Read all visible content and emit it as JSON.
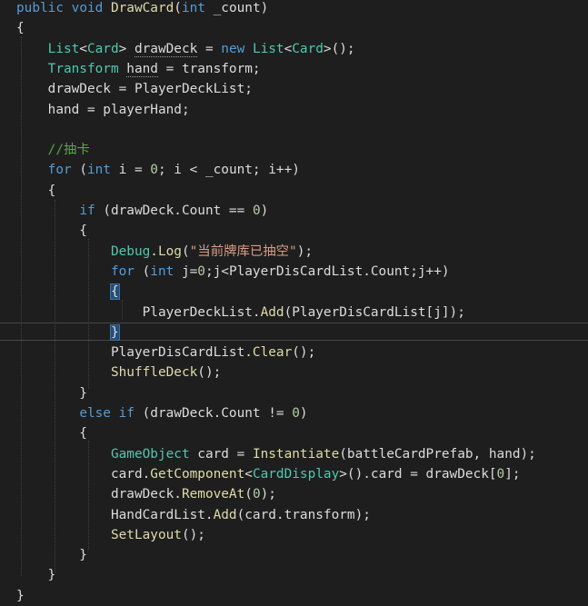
{
  "editor": {
    "lines": [
      [
        {
          "t": "public ",
          "c": "kw"
        },
        {
          "t": "void ",
          "c": "kw"
        },
        {
          "t": "DrawCard",
          "c": "method"
        },
        {
          "t": "(",
          "c": "p"
        },
        {
          "t": "int ",
          "c": "kw"
        },
        {
          "t": "_count)",
          "c": "p"
        }
      ],
      [
        {
          "t": "{",
          "c": "p"
        }
      ],
      [
        {
          "t": "    ",
          "c": "p"
        },
        {
          "t": "List",
          "c": "type"
        },
        {
          "t": "<",
          "c": "p"
        },
        {
          "t": "Card",
          "c": "type"
        },
        {
          "t": "> ",
          "c": "p"
        },
        {
          "t": "drawDeck",
          "c": "ul"
        },
        {
          "t": " = ",
          "c": "p"
        },
        {
          "t": "new ",
          "c": "kw"
        },
        {
          "t": "List",
          "c": "type"
        },
        {
          "t": "<",
          "c": "p"
        },
        {
          "t": "Card",
          "c": "type"
        },
        {
          "t": ">();",
          "c": "p"
        }
      ],
      [
        {
          "t": "    ",
          "c": "p"
        },
        {
          "t": "Transform ",
          "c": "type"
        },
        {
          "t": "hand",
          "c": "ul"
        },
        {
          "t": " = transform;",
          "c": "p"
        }
      ],
      [
        {
          "t": "    drawDeck = PlayerDeckList;",
          "c": "p"
        }
      ],
      [
        {
          "t": "    hand = playerHand;",
          "c": "p"
        }
      ],
      [
        {
          "t": "",
          "c": "p"
        }
      ],
      [
        {
          "t": "    ",
          "c": "p"
        },
        {
          "t": "//抽卡",
          "c": "cmt"
        }
      ],
      [
        {
          "t": "    ",
          "c": "p"
        },
        {
          "t": "for ",
          "c": "kw"
        },
        {
          "t": "(",
          "c": "p"
        },
        {
          "t": "int ",
          "c": "kw"
        },
        {
          "t": "i = ",
          "c": "p"
        },
        {
          "t": "0",
          "c": "num"
        },
        {
          "t": "; i < _count; i++)",
          "c": "p"
        }
      ],
      [
        {
          "t": "    {",
          "c": "p"
        }
      ],
      [
        {
          "t": "        ",
          "c": "p"
        },
        {
          "t": "if ",
          "c": "kw"
        },
        {
          "t": "(drawDeck.Count == ",
          "c": "p"
        },
        {
          "t": "0",
          "c": "num"
        },
        {
          "t": ")",
          "c": "p"
        }
      ],
      [
        {
          "t": "        {",
          "c": "p"
        }
      ],
      [
        {
          "t": "            ",
          "c": "p"
        },
        {
          "t": "Debug",
          "c": "type"
        },
        {
          "t": ".",
          "c": "p"
        },
        {
          "t": "Log",
          "c": "method"
        },
        {
          "t": "(",
          "c": "p"
        },
        {
          "t": "\"当前牌库已抽空\"",
          "c": "str"
        },
        {
          "t": ");",
          "c": "p"
        }
      ],
      [
        {
          "t": "            ",
          "c": "p"
        },
        {
          "t": "for ",
          "c": "kw"
        },
        {
          "t": "(",
          "c": "p"
        },
        {
          "t": "int ",
          "c": "kw"
        },
        {
          "t": "j=",
          "c": "p"
        },
        {
          "t": "0",
          "c": "num"
        },
        {
          "t": ";j<PlayerDisCardList.Count;j++)",
          "c": "p"
        }
      ],
      [
        {
          "t": "            ",
          "c": "p"
        },
        {
          "t": "{",
          "c": "brace-hl"
        }
      ],
      [
        {
          "t": "                PlayerDeckList.",
          "c": "p"
        },
        {
          "t": "Add",
          "c": "method"
        },
        {
          "t": "(PlayerDisCardList[j]);",
          "c": "p"
        }
      ],
      [
        {
          "t": "            ",
          "c": "p"
        },
        {
          "t": "}",
          "c": "brace-hl"
        },
        {
          "t": "",
          "c": "caret"
        }
      ],
      [
        {
          "t": "            PlayerDisCardList.",
          "c": "p"
        },
        {
          "t": "Clear",
          "c": "method"
        },
        {
          "t": "();",
          "c": "p"
        }
      ],
      [
        {
          "t": "            ",
          "c": "p"
        },
        {
          "t": "ShuffleDeck",
          "c": "method"
        },
        {
          "t": "();",
          "c": "p"
        }
      ],
      [
        {
          "t": "        }",
          "c": "p"
        }
      ],
      [
        {
          "t": "        ",
          "c": "p"
        },
        {
          "t": "else if ",
          "c": "kw"
        },
        {
          "t": "(drawDeck.Count != ",
          "c": "p"
        },
        {
          "t": "0",
          "c": "num"
        },
        {
          "t": ")",
          "c": "p"
        }
      ],
      [
        {
          "t": "        {",
          "c": "p"
        }
      ],
      [
        {
          "t": "            ",
          "c": "p"
        },
        {
          "t": "GameObject ",
          "c": "type"
        },
        {
          "t": "card = ",
          "c": "p"
        },
        {
          "t": "Instantiate",
          "c": "method"
        },
        {
          "t": "(battleCardPrefab, hand);",
          "c": "p"
        }
      ],
      [
        {
          "t": "            card.",
          "c": "p"
        },
        {
          "t": "GetComponent",
          "c": "method"
        },
        {
          "t": "<",
          "c": "p"
        },
        {
          "t": "CardDisplay",
          "c": "type"
        },
        {
          "t": ">().card = drawDeck[",
          "c": "p"
        },
        {
          "t": "0",
          "c": "num"
        },
        {
          "t": "];",
          "c": "p"
        }
      ],
      [
        {
          "t": "            drawDeck.",
          "c": "p"
        },
        {
          "t": "RemoveAt",
          "c": "method"
        },
        {
          "t": "(",
          "c": "p"
        },
        {
          "t": "0",
          "c": "num"
        },
        {
          "t": ");",
          "c": "p"
        }
      ],
      [
        {
          "t": "            HandCardList.",
          "c": "p"
        },
        {
          "t": "Add",
          "c": "method"
        },
        {
          "t": "(card.transform);",
          "c": "p"
        }
      ],
      [
        {
          "t": "            ",
          "c": "p"
        },
        {
          "t": "SetLayout",
          "c": "method"
        },
        {
          "t": "();",
          "c": "p"
        }
      ],
      [
        {
          "t": "        }",
          "c": "p"
        }
      ],
      [
        {
          "t": "    }",
          "c": "p"
        }
      ],
      [
        {
          "t": "}",
          "c": "p"
        }
      ]
    ]
  }
}
